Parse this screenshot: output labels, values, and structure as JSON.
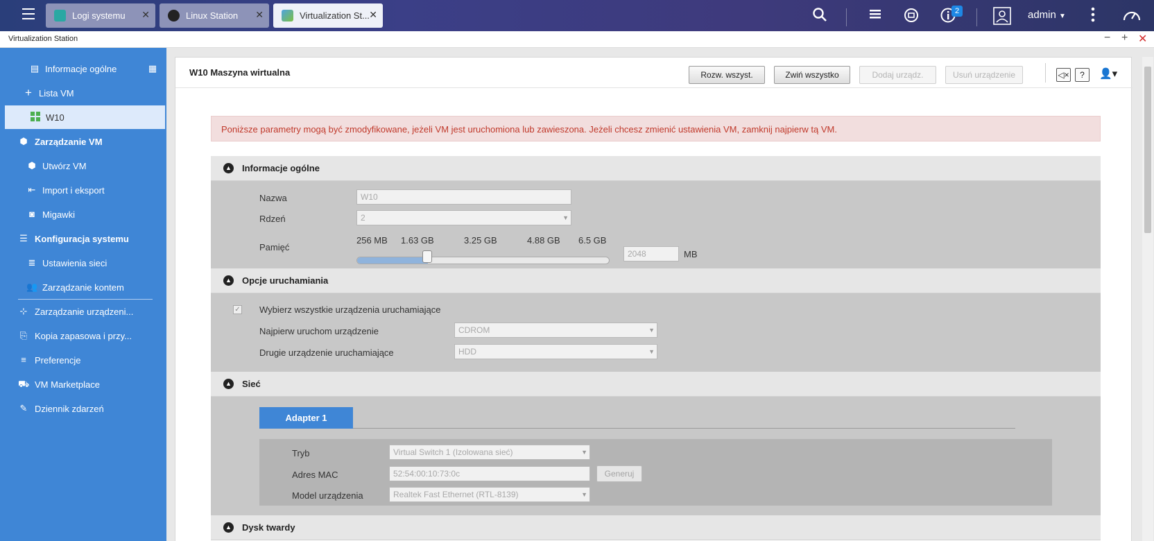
{
  "taskbar": {
    "tabs": [
      {
        "label": "Logi systemu",
        "icon": "log-icon",
        "active": false
      },
      {
        "label": "Linux Station",
        "icon": "tux-icon",
        "active": false
      },
      {
        "label": "Virtualization St...",
        "icon": "virtualization-cube-icon",
        "active": true
      }
    ],
    "notification_count": "2",
    "user": "admin",
    "icons": [
      "menu-icon",
      "search-icon",
      "stack-icon",
      "sync-icon",
      "info-icon",
      "user-icon",
      "more-vertical-icon",
      "dashboard-gauge-icon"
    ]
  },
  "window": {
    "title": "Virtualization Station",
    "minimize": "−",
    "maximize": "+",
    "close": "✕"
  },
  "sidebar": {
    "items": [
      {
        "label": "Informacje ogólne",
        "icon": "monitor-icon"
      },
      {
        "label": "Lista VM",
        "icon": "plus-icon"
      },
      {
        "label": "W10",
        "icon": "windows-icon",
        "selected": true
      },
      {
        "label": "Zarządzanie VM",
        "icon": "cubes-icon"
      },
      {
        "label": "Utwórz VM",
        "icon": "cubes-small-icon"
      },
      {
        "label": "Import i eksport",
        "icon": "import-icon"
      },
      {
        "label": "Migawki",
        "icon": "camera-icon"
      },
      {
        "label": "Konfiguracja systemu",
        "icon": "sliders-icon"
      },
      {
        "label": "Ustawienia sieci",
        "icon": "database-icon"
      },
      {
        "label": "Zarządzanie kontem",
        "icon": "users-icon"
      },
      {
        "label": "Zarządzanie urządzeni...",
        "icon": "network-tree-icon"
      },
      {
        "label": "Kopia zapasowa i przy...",
        "icon": "backup-icon"
      },
      {
        "label": "Preferencje",
        "icon": "list-icon"
      },
      {
        "label": "VM Marketplace",
        "icon": "cart-icon"
      },
      {
        "label": "Dziennik zdarzeń",
        "icon": "journal-icon"
      }
    ]
  },
  "panel": {
    "title": "W10 Maszyna wirtualna",
    "buttons": {
      "expand_all": "Rozw. wszyst.",
      "collapse_all": "Zwiń wszystko",
      "add_device": "Dodaj urządz.",
      "remove_device": "Usuń urządzenie"
    },
    "help": "?",
    "warning": "Poniższe parametry mogą być zmodyfikowane, jeżeli VM jest uruchomiona lub zawieszona. Jeżeli chcesz zmienić ustawienia VM, zamknij najpierw tą VM."
  },
  "general": {
    "title": "Informacje ogólne",
    "name_label": "Nazwa",
    "name_value": "W10",
    "core_label": "Rdzeń",
    "core_value": "2",
    "memory_label": "Pamięć",
    "memory_ticks": [
      "256 MB",
      "1.63 GB",
      "3.25 GB",
      "4.88 GB",
      "6.5 GB"
    ],
    "memory_value": "2048",
    "memory_unit": "MB",
    "memory_slider_fraction": 0.28
  },
  "boot": {
    "title": "Opcje uruchamiania",
    "select_all_label": "Wybierz wszystkie urządzenia uruchamiające",
    "select_all_checked": true,
    "first_label": "Najpierw uruchom urządzenie",
    "first_value": "CDROM",
    "second_label": "Drugie urządzenie uruchamiające",
    "second_value": "HDD"
  },
  "network": {
    "title": "Sieć",
    "adapter_tab": "Adapter 1",
    "mode_label": "Tryb",
    "mode_value": "Virtual Switch 1 (Izolowana sieć)",
    "mac_label": "Adres MAC",
    "mac_value": "52:54:00:10:73:0c",
    "generate_label": "Generuj",
    "model_label": "Model urządzenia",
    "model_value": "Realtek Fast Ethernet (RTL-8139)"
  },
  "disk": {
    "title": "Dysk twardy"
  }
}
